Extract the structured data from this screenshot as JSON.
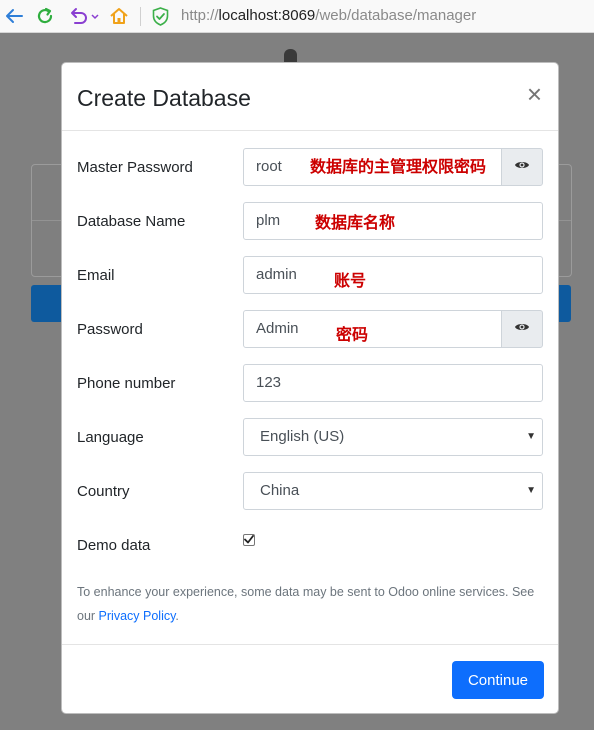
{
  "browser": {
    "url_scheme": "http://",
    "url_host": "localhost:8069",
    "url_path": "/web/database/manager"
  },
  "modal": {
    "title": "Create Database",
    "close_glyph": "×",
    "fields": {
      "master_password": {
        "label": "Master Password",
        "value": "root",
        "annotation": "数据库的主管理权限密码"
      },
      "database_name": {
        "label": "Database Name",
        "value": "plm",
        "annotation": "数据库名称"
      },
      "email": {
        "label": "Email",
        "value": "admin",
        "annotation": "账号"
      },
      "password": {
        "label": "Password",
        "value": "Admin",
        "annotation": "密码"
      },
      "phone": {
        "label": "Phone number",
        "value": "123"
      },
      "language": {
        "label": "Language",
        "value": "English (US)"
      },
      "country": {
        "label": "Country",
        "value": "China"
      },
      "demo_data": {
        "label": "Demo data",
        "checked": true
      }
    },
    "note": {
      "text": "To enhance your experience, some data may be sent to Odoo online services. See our ",
      "link": "Privacy Policy",
      "suffix": "."
    },
    "continue_label": "Continue"
  },
  "icons": {
    "back": "back-arrow-icon",
    "reload": "reload-icon",
    "undo": "undo-icon",
    "home": "home-icon",
    "shield": "shield-icon",
    "eye": "eye-icon",
    "caret": "caret-down-icon",
    "check": "checkmark-icon"
  },
  "colors": {
    "primary": "#0d6efd",
    "annotation": "#cc0000",
    "backdrop": "#808080"
  }
}
